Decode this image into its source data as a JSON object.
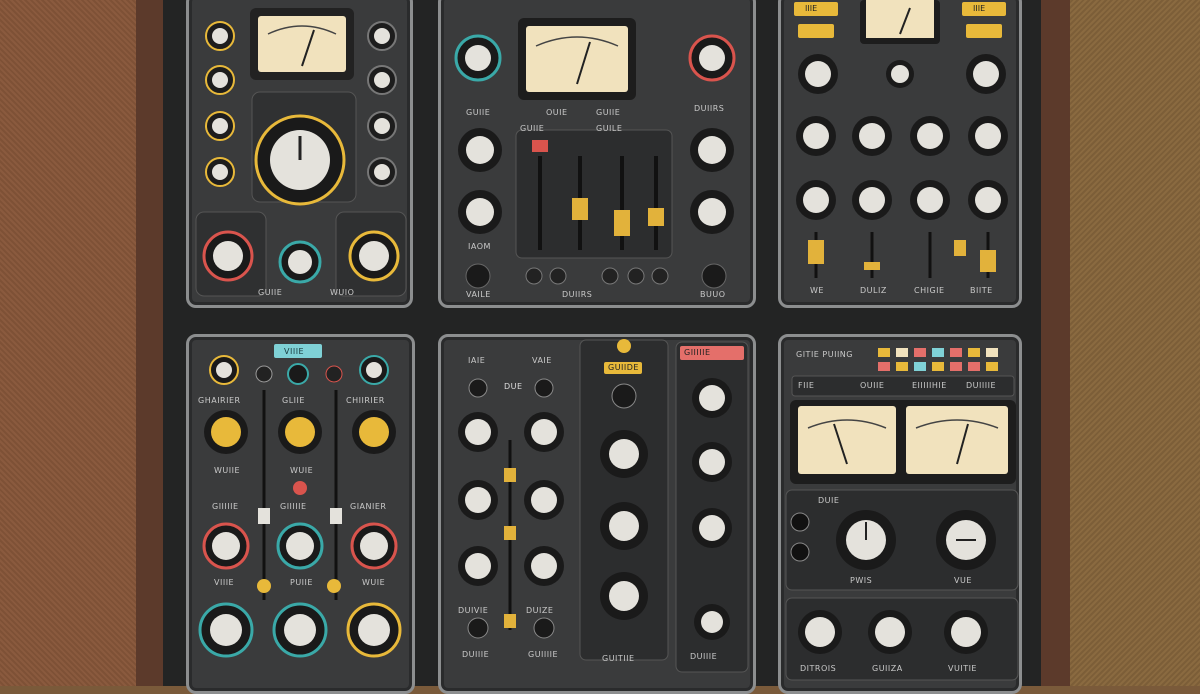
{
  "scene": "rack",
  "colors": {
    "panel": "#3a3b3c",
    "knob_face": "#e4e2dc",
    "meter_face": "#f1e2bd",
    "accent_yellow": "#e8b93a",
    "accent_red": "#d9544d",
    "accent_teal": "#3aa9a8",
    "fader_gold": "#e2b23b"
  },
  "modules": [
    {
      "id": "m1",
      "labels": [
        "GUIIE",
        "WUIO"
      ]
    },
    {
      "id": "m2",
      "labels": [
        "GUIIE",
        "GUIIE",
        "OUIE",
        "GUIIE",
        "GUILE",
        "DUIIRS",
        "IAOM",
        "VAILE",
        "DUIIRS",
        "BUUO"
      ]
    },
    {
      "id": "m3",
      "labels": [
        "IIIE",
        "IIIE",
        "WE",
        "DULIZ",
        "CHIGIE",
        "BIITE"
      ]
    },
    {
      "id": "m4",
      "labels": [
        "VIIIE",
        "GHAIRIER",
        "GLIIE",
        "CHIIRIER",
        "WUIIE",
        "WUIE",
        "GIIIIIE",
        "GIIIIIE",
        "GIANIER",
        "VIIIE",
        "PUIIE",
        "WUIE"
      ]
    },
    {
      "id": "m5",
      "labels": [
        "IAIE",
        "VAIE",
        "DUE",
        "GIIIIIE",
        "GUIIDE",
        "DUIVIE",
        "DUIZE",
        "DUIIIE",
        "GUIIIIE",
        "GUITIIE",
        "DUIIIE"
      ]
    },
    {
      "id": "m6",
      "labels": [
        "GITIE PUIING",
        "FIIE",
        "OUIIE",
        "EIIIIIHIE",
        "DUIIIIE",
        "DUIE",
        "PWIS",
        "VUE",
        "DITROIS",
        "GUIIZA",
        "VUITIE"
      ]
    }
  ]
}
